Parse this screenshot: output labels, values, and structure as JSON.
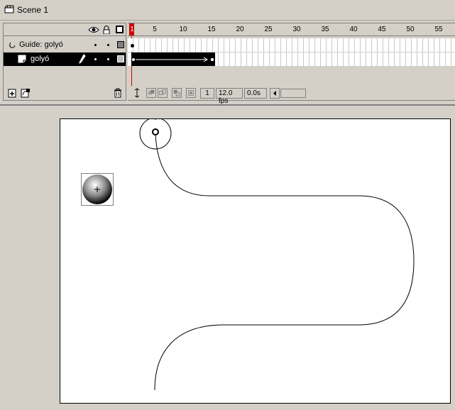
{
  "scene": {
    "title": "Scene 1",
    "icon": "clapperboard-icon"
  },
  "timeline": {
    "header_icons": [
      "eye-icon",
      "lock-icon",
      "outline-icon"
    ],
    "layers": [
      {
        "name": "Guide: golyó",
        "type": "guide",
        "icon": "guide-layer-icon",
        "selected": false
      },
      {
        "name": "golyó",
        "type": "normal",
        "icon": "layer-icon",
        "selected": true,
        "editing_icon": "pencil-icon"
      }
    ],
    "ruler_labels": [
      "1",
      "5",
      "10",
      "15",
      "20",
      "25",
      "30",
      "35",
      "40",
      "45",
      "50",
      "55"
    ],
    "current_frame": "1",
    "frame_rate": "12.0 fps",
    "elapsed_time": "0.0s",
    "layer_tools": [
      "add-layer-icon",
      "add-guide-layer-icon",
      "trash-icon"
    ],
    "status_tools": [
      "center-frame-icon",
      "onion-skin-icon",
      "onion-skin-outlines-icon",
      "edit-multiple-frames-icon",
      "modify-onion-markers-icon"
    ]
  },
  "colors": {
    "chrome": "#d4d0c8",
    "selected_layer": "#000000",
    "stage": "#ffffff",
    "playhead": "#cc0000"
  }
}
